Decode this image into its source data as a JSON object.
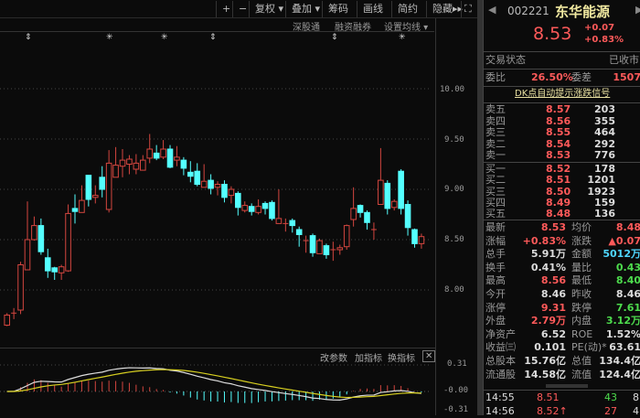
{
  "toolbar": {
    "plus": "+",
    "minus": "−",
    "fuquan": "复权",
    "diejia": "叠加",
    "chouma": "筹码",
    "huaxian": "画线",
    "jianyue": "简约",
    "yincang": "隐藏",
    "fullscreen": "⛶"
  },
  "subbar": {
    "shengutong": "深股通",
    "rongzi": "融资融券",
    "ma_settings": "设置均线"
  },
  "markers": [
    {
      "sym": "⇕"
    },
    {
      "sym": "✳"
    },
    {
      "sym": "✳"
    },
    {
      "sym": "⇕"
    },
    {
      "sym": "⇕"
    },
    {
      "sym": "✳"
    }
  ],
  "indicator_bar": {
    "change_params": "改参数",
    "add_indicator": "加指标",
    "switch_indicator": "换指标",
    "close": "✕"
  },
  "quote": {
    "code": "002221",
    "name": "东华能源",
    "price": "8.53",
    "change": "+0.07",
    "change_pct": "+0.83%",
    "status_label": "交易状态",
    "status": "已收市",
    "weibi_label": "委比",
    "weibi": "26.50%",
    "weicha_label": "委差",
    "weicha": "1507",
    "signal_link": "DK点自动提示涨跌信号",
    "asks": [
      {
        "label": "卖五",
        "price": "8.57",
        "vol": "203"
      },
      {
        "label": "卖四",
        "price": "8.56",
        "vol": "355"
      },
      {
        "label": "卖三",
        "price": "8.55",
        "vol": "464"
      },
      {
        "label": "卖二",
        "price": "8.54",
        "vol": "292"
      },
      {
        "label": "卖一",
        "price": "8.53",
        "vol": "776"
      }
    ],
    "bids": [
      {
        "label": "买一",
        "price": "8.52",
        "vol": "178"
      },
      {
        "label": "买二",
        "price": "8.51",
        "vol": "1201"
      },
      {
        "label": "买三",
        "price": "8.50",
        "vol": "1923"
      },
      {
        "label": "买四",
        "price": "8.49",
        "vol": "159"
      },
      {
        "label": "买五",
        "price": "8.48",
        "vol": "136"
      }
    ],
    "stats": [
      {
        "l1": "最新",
        "v1": "8.53",
        "c1": "red",
        "l2": "均价",
        "v2": "8.48",
        "c2": "red"
      },
      {
        "l1": "涨幅",
        "v1": "+0.83%",
        "c1": "red",
        "l2": "涨跌",
        "v2": "▲0.07",
        "c2": "red"
      },
      {
        "l1": "总手",
        "v1": "5.91万",
        "c1": "wh",
        "l2": "金额",
        "v2": "5012万",
        "c2": "cy"
      },
      {
        "l1": "换手",
        "v1": "0.41%",
        "c1": "wh",
        "l2": "量比",
        "v2": "0.43",
        "c2": "grn"
      },
      {
        "l1": "最高",
        "v1": "8.56",
        "c1": "red",
        "l2": "最低",
        "v2": "8.40",
        "c2": "grn"
      },
      {
        "l1": "今开",
        "v1": "8.46",
        "c1": "wh",
        "l2": "昨收",
        "v2": "8.46",
        "c2": "wh"
      },
      {
        "l1": "涨停",
        "v1": "9.31",
        "c1": "red",
        "l2": "跌停",
        "v2": "7.61",
        "c2": "grn"
      },
      {
        "l1": "外盘",
        "v1": "2.79万",
        "c1": "red",
        "l2": "内盘",
        "v2": "3.12万",
        "c2": "grn"
      },
      {
        "l1": "净资产",
        "v1": "6.52",
        "c1": "wh",
        "l2": "ROE",
        "v2": "1.52%",
        "c2": "wh"
      },
      {
        "l1": "收益㈢",
        "v1": "0.101",
        "c1": "wh",
        "l2": "PE(动)*",
        "v2": "63.61",
        "c2": "wh"
      },
      {
        "l1": "总股本",
        "v1": "15.76亿",
        "c1": "wh",
        "l2": "总值",
        "v2": "134.4亿",
        "c2": "wh"
      },
      {
        "l1": "流通股",
        "v1": "14.58亿",
        "c1": "wh",
        "l2": "流值",
        "v2": "124.4亿",
        "c2": "wh"
      }
    ],
    "ticks": [
      {
        "time": "14:55",
        "price": "8.51",
        "vol": "43",
        "n": "8"
      },
      {
        "time": "14:56",
        "price": "8.52↑",
        "vol": "27",
        "n": "4"
      }
    ]
  },
  "chart_data": {
    "type": "candlestick",
    "ylim": [
      7.55,
      10.25
    ],
    "y_ticks": [
      "10.00",
      "9.50",
      "9.00",
      "8.50",
      "8.00"
    ],
    "macd_ticks": [
      "0.31",
      "-0.00",
      "-0.31"
    ],
    "colors": {
      "up": "#d4463f",
      "down": "#54ffff",
      "dif": "#dddddd",
      "dea": "#d8d020"
    },
    "ohlc": [
      [
        7.65,
        7.77,
        7.64,
        7.75
      ],
      [
        7.77,
        7.82,
        7.71,
        7.77
      ],
      [
        7.8,
        8.28,
        7.76,
        8.25
      ],
      [
        8.2,
        8.88,
        8.2,
        8.5
      ],
      [
        8.5,
        8.73,
        8.49,
        8.64
      ],
      [
        8.64,
        8.71,
        8.35,
        8.38
      ],
      [
        8.32,
        8.41,
        8.12,
        8.19
      ],
      [
        8.22,
        8.23,
        8.1,
        8.18
      ],
      [
        8.17,
        8.25,
        8.1,
        8.23
      ],
      [
        8.19,
        8.85,
        8.18,
        8.76
      ],
      [
        8.81,
        8.95,
        8.66,
        8.78
      ],
      [
        8.77,
        9.04,
        8.77,
        8.89
      ],
      [
        9.14,
        9.14,
        8.83,
        8.9
      ],
      [
        8.92,
        9.04,
        8.86,
        8.94
      ],
      [
        9.12,
        9.23,
        8.92,
        9.0
      ],
      [
        8.8,
        9.39,
        8.77,
        9.26
      ],
      [
        9.12,
        9.42,
        9.12,
        9.24
      ],
      [
        9.23,
        9.4,
        9.12,
        9.29
      ],
      [
        9.25,
        9.34,
        9.15,
        9.3
      ],
      [
        9.2,
        9.35,
        9.15,
        9.26
      ],
      [
        9.19,
        9.34,
        9.19,
        9.29
      ],
      [
        9.31,
        9.55,
        9.26,
        9.4
      ],
      [
        9.36,
        9.44,
        9.29,
        9.31
      ],
      [
        9.32,
        9.49,
        9.3,
        9.4
      ],
      [
        9.4,
        9.44,
        9.21,
        9.22
      ],
      [
        9.29,
        9.43,
        9.23,
        9.32
      ],
      [
        9.29,
        9.32,
        9.14,
        9.21
      ],
      [
        9.17,
        9.28,
        9.07,
        9.13
      ],
      [
        9.18,
        9.26,
        9.03,
        9.05
      ],
      [
        9.02,
        9.25,
        9.02,
        9.08
      ],
      [
        9.09,
        9.15,
        8.95,
        9.01
      ],
      [
        9.02,
        9.08,
        8.94,
        9.05
      ],
      [
        9.05,
        9.09,
        8.87,
        8.92
      ],
      [
        8.94,
        9.03,
        8.86,
        9.0
      ],
      [
        8.96,
        8.98,
        8.74,
        8.82
      ],
      [
        8.79,
        8.88,
        8.77,
        8.84
      ],
      [
        8.83,
        8.86,
        8.74,
        8.78
      ],
      [
        8.77,
        8.9,
        8.75,
        8.83
      ],
      [
        8.86,
        8.88,
        8.75,
        8.81
      ],
      [
        8.87,
        8.89,
        8.69,
        8.71
      ],
      [
        8.66,
        9.0,
        8.66,
        8.71
      ],
      [
        8.66,
        8.71,
        8.58,
        8.66
      ],
      [
        8.69,
        8.71,
        8.57,
        8.64
      ],
      [
        8.6,
        8.63,
        8.43,
        8.55
      ],
      [
        8.49,
        8.54,
        8.37,
        8.49
      ],
      [
        8.54,
        8.56,
        8.33,
        8.37
      ],
      [
        8.36,
        8.51,
        8.36,
        8.49
      ],
      [
        8.44,
        8.46,
        8.31,
        8.35
      ],
      [
        8.4,
        8.48,
        8.29,
        8.4
      ],
      [
        8.4,
        8.45,
        8.35,
        8.42
      ],
      [
        8.43,
        8.65,
        8.4,
        8.64
      ],
      [
        8.7,
        9.02,
        8.63,
        8.81
      ],
      [
        8.84,
        8.85,
        8.72,
        8.77
      ],
      [
        8.77,
        8.79,
        8.6,
        8.67
      ],
      [
        8.6,
        8.67,
        8.5,
        8.6
      ],
      [
        8.85,
        9.41,
        8.85,
        9.09
      ],
      [
        9.06,
        9.09,
        8.75,
        8.81
      ],
      [
        8.82,
        8.9,
        8.79,
        8.88
      ],
      [
        9.18,
        9.2,
        8.75,
        8.81
      ],
      [
        8.85,
        8.89,
        8.54,
        8.62
      ],
      [
        8.6,
        8.61,
        8.42,
        8.46
      ],
      [
        8.46,
        8.56,
        8.41,
        8.53
      ]
    ]
  }
}
